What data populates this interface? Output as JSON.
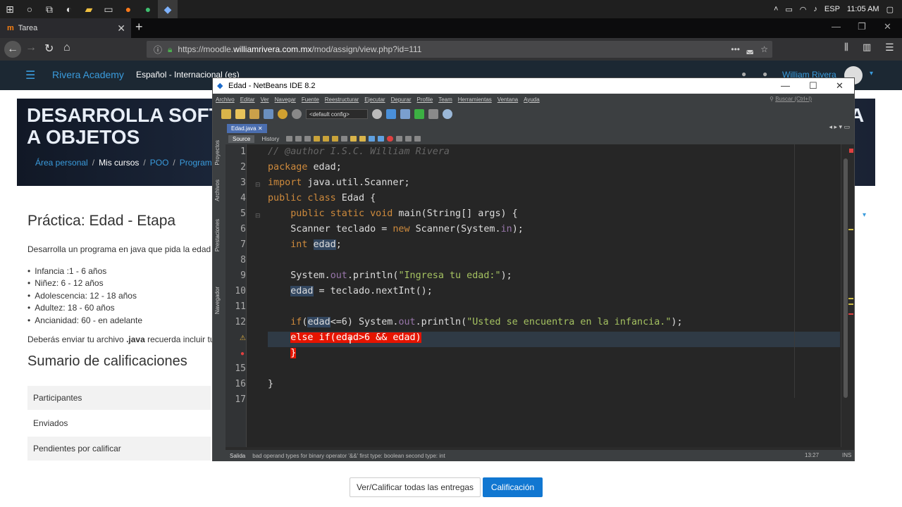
{
  "taskbar": {
    "lang": "ESP",
    "time": "11:05 AM"
  },
  "browser": {
    "tab_title": "Tarea",
    "url_prefix": "https://moodle.",
    "url_host": "williamrivera.com.mx",
    "url_path": "/mod/assign/view.php?id=111",
    "url_dots": "•••"
  },
  "moodle": {
    "brand": "Rivera Academy",
    "lang": "Español - Internacional (es)",
    "user": "William Rivera",
    "banner_line1": "DESARROLLA SOFT",
    "banner_line2": "A OBJETOS",
    "banner_right": "A",
    "breadcrumbs": [
      "Área personal",
      "Mis cursos",
      "POO",
      "Programa"
    ],
    "page_title": "Práctica: Edad - Etapa",
    "description": "Desarrolla un programa en java que pida la edad d",
    "stages": [
      "Infancia :1 - 6 años",
      "Niñez: 6 - 12 años",
      "Adolescencia: 12 - 18 años",
      "Adultez: 18 - 60 años",
      "Ancianidad: 60 - en adelante"
    ],
    "send_note_pre": "Deberás enviar tu archivo ",
    "send_note_bold": ".java",
    "send_note_post": " recuerda incluir tu",
    "summary_title": "Sumario de calificaciones",
    "summary_rows": [
      "Participantes",
      "Enviados",
      "Pendientes por calificar"
    ],
    "btn_grade_all": "Ver/Calificar todas las entregas",
    "btn_grade": "Calificación"
  },
  "netbeans": {
    "title": "Edad - NetBeans IDE 8.2",
    "menu": [
      "Archivo",
      "Editar",
      "Ver",
      "Navegar",
      "Fuente",
      "Reestructurar",
      "Ejecutar",
      "Depurar",
      "Profile",
      "Team",
      "Herramientas",
      "Ventana",
      "Ayuda"
    ],
    "search": "Buscar (Ctrl+I)",
    "config": "<default config>",
    "side_labels": [
      "Proyectos",
      "Archivos",
      "Prestaciones",
      "Navegador"
    ],
    "file_tab": "Edad.java",
    "editor_tabs": [
      "Source",
      "History"
    ],
    "status_output": "Salida",
    "status_message": "bad operand types for binary operator '&&'   first type:  boolean   second type: int",
    "status_pos": "13:27",
    "status_mode": "INS",
    "line_numbers": [
      "1",
      "2",
      "3",
      "4",
      "5",
      "6",
      "7",
      "8",
      "9",
      "10",
      "11",
      "12",
      "",
      "",
      "15",
      "16",
      "17"
    ]
  }
}
